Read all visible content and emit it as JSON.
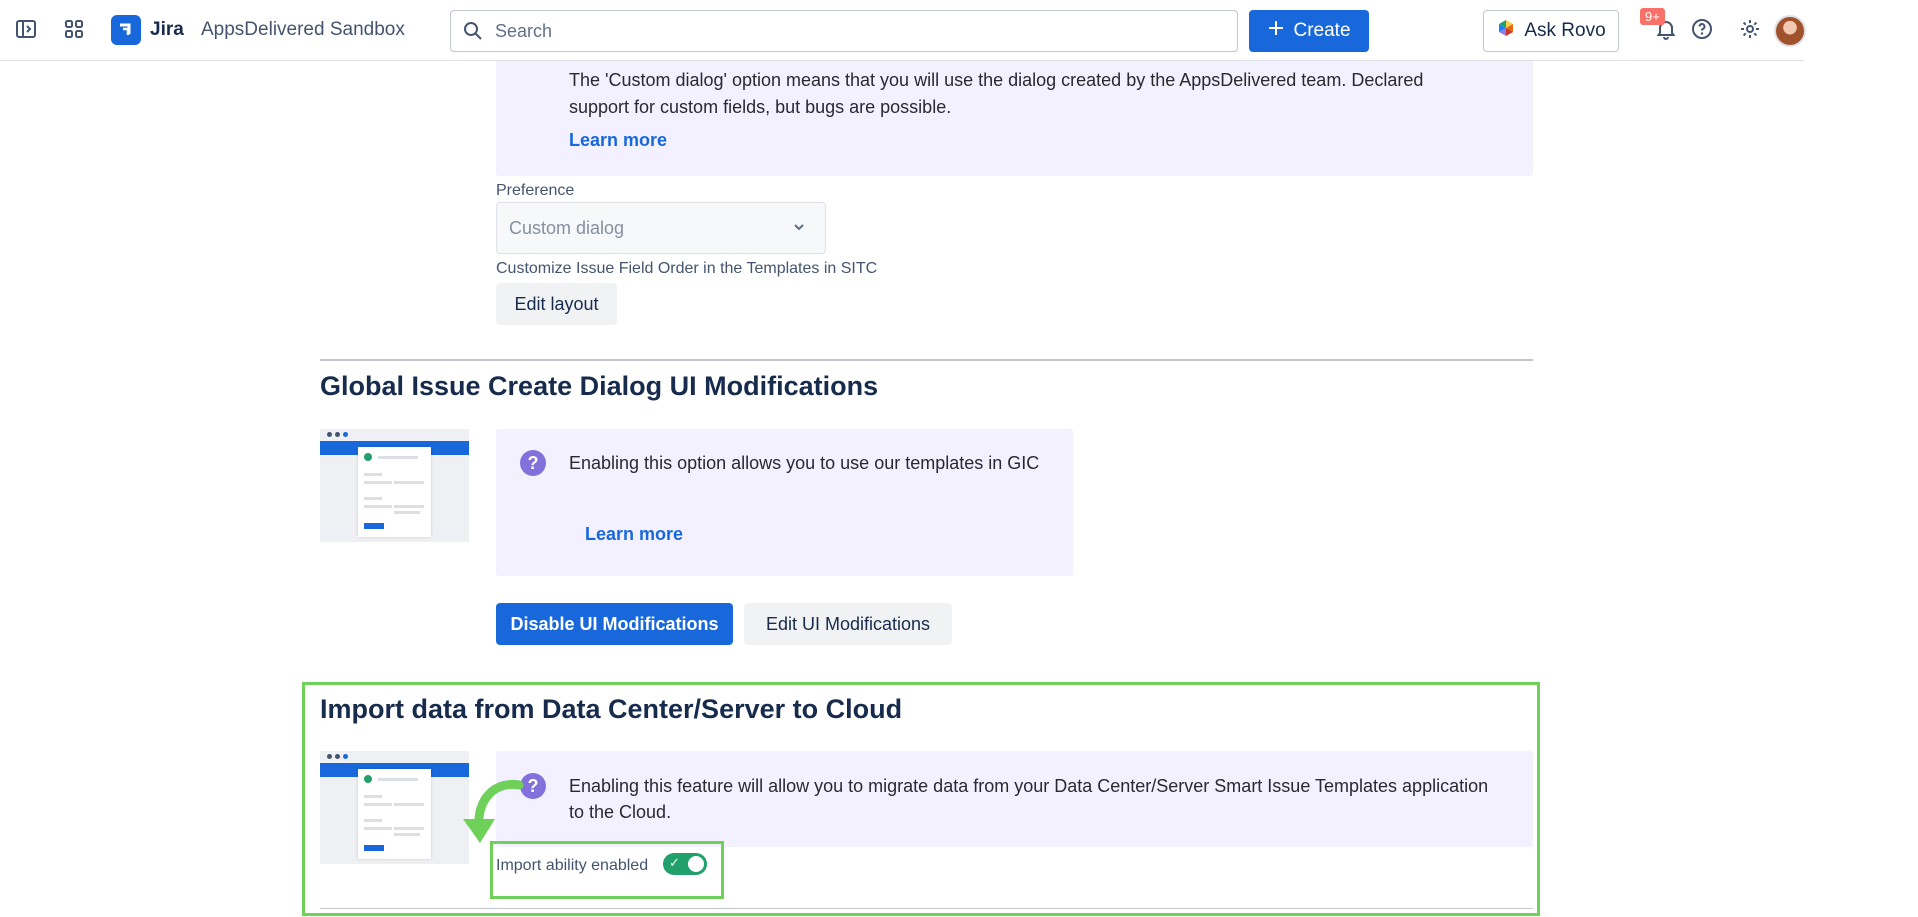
{
  "topbar": {
    "app_name": "Jira",
    "site_name": "AppsDelivered Sandbox",
    "search_placeholder": "Search",
    "create_label": "Create",
    "rovo_label": "Ask Rovo",
    "notifications_badge": "9+"
  },
  "custom_dialog": {
    "note": "The 'Custom dialog' option means that you will use the dialog created by the AppsDelivered team. Declared support for custom fields, but bugs are possible.",
    "learn_more": "Learn more",
    "preference_label": "Preference",
    "preference_value": "Custom dialog",
    "field_order_label": "Customize Issue Field Order in the Templates in SITC",
    "edit_layout": "Edit layout"
  },
  "gic": {
    "title": "Global Issue Create Dialog UI Modifications",
    "note": "Enabling this option allows you to use our templates in GIC",
    "learn_more": "Learn more",
    "disable_button": "Disable UI Modifications",
    "edit_button": "Edit UI Modifications"
  },
  "import": {
    "title": "Import data from Data Center/Server to Cloud",
    "note": "Enabling this feature will allow you to migrate data from your Data Center/Server Smart Issue Templates application to the Cloud.",
    "toggle_label": "Import ability enabled",
    "toggle_on": true
  },
  "colors": {
    "accent": "#1868db",
    "note_bg": "#f3f0ff",
    "highlight": "#6fd05a",
    "toggle_on": "#22a06b"
  }
}
